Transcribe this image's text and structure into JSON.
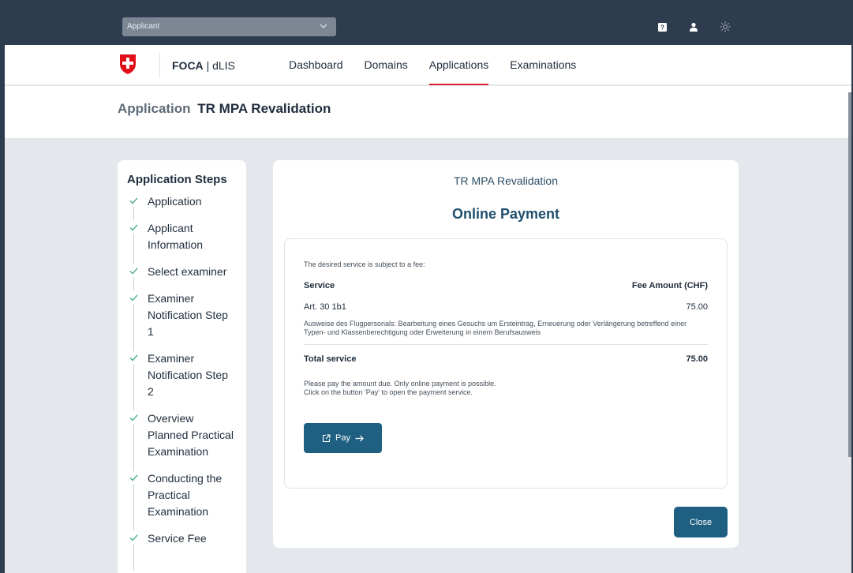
{
  "topbar": {
    "role_select": "Applicant",
    "icons": [
      "help-icon",
      "user-icon",
      "theme-sun-icon"
    ]
  },
  "nav": {
    "brand_bold": "FOCA",
    "brand_sep": "|",
    "brand_rest": "dLIS",
    "items": [
      {
        "label": "Dashboard",
        "active": false
      },
      {
        "label": "Domains",
        "active": false
      },
      {
        "label": "Applications",
        "active": true
      },
      {
        "label": "Examinations",
        "active": false
      }
    ]
  },
  "page": {
    "title_prefix": "Application",
    "title": "TR MPA Revalidation"
  },
  "steps": {
    "heading": "Application Steps",
    "items": [
      {
        "label": "Application",
        "done": true
      },
      {
        "label": "Applicant Information",
        "done": true
      },
      {
        "label": "Select examiner",
        "done": true
      },
      {
        "label": "Examiner Notification Step 1",
        "done": true
      },
      {
        "label": "Examiner Notification Step 2",
        "done": true
      },
      {
        "label": "Overview Planned Practical Examination",
        "done": true
      },
      {
        "label": "Conducting the Practical Examination",
        "done": true
      },
      {
        "label": "Service Fee",
        "done": true
      }
    ]
  },
  "payment": {
    "subtitle": "TR MPA Revalidation",
    "title": "Online Payment",
    "intro": "The desired service is subject to a fee:",
    "col_service": "Service",
    "col_fee": "Fee Amount (CHF)",
    "service_name": "Art. 30 1b1",
    "service_amount": "75.00",
    "service_desc": "Ausweise des Flugpersonals: Bearbeitung eines Gesuchs um Ersteintrag, Erneuerung oder Verlängerung betreffend einer Typen- und Klassenberechtigung oder Erweiterung in einem Berufsausweis",
    "total_label": "Total service",
    "total_amount": "75.00",
    "note_line1": "Please pay the amount due. Only online payment is possible.",
    "note_line2": "Click on the button 'Pay' to open the payment service.",
    "pay_label": "Pay",
    "close_label": "Close"
  },
  "colors": {
    "topbar": "#2d3c4e",
    "primary_button": "#1e5f82",
    "active_tab": "#d8232a",
    "swiss_red": "#e0101a",
    "check": "#4caf8a"
  }
}
